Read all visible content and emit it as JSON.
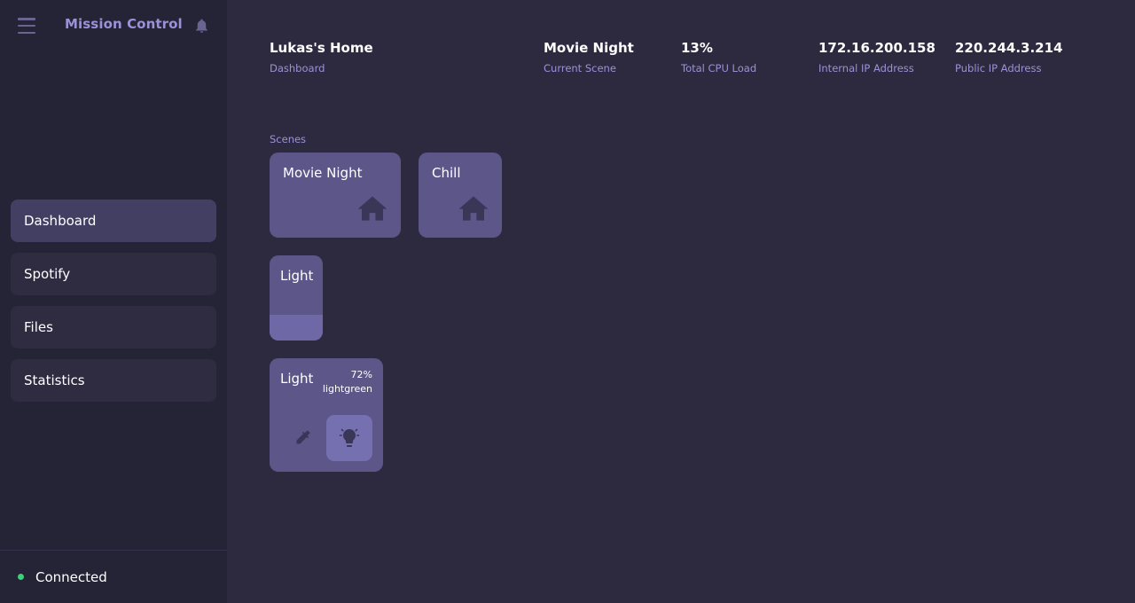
{
  "app": {
    "title": "Mission Control"
  },
  "sidebar": {
    "items": [
      {
        "label": "Dashboard",
        "active": true
      },
      {
        "label": "Spotify",
        "active": false
      },
      {
        "label": "Files",
        "active": false
      },
      {
        "label": "Statistics",
        "active": false
      }
    ],
    "status": "Connected",
    "status_color": "#3bd07a"
  },
  "header": {
    "home": {
      "value": "Lukas's Home",
      "label": "Dashboard"
    },
    "scene": {
      "value": "Movie Night",
      "label": "Current Scene"
    },
    "cpu": {
      "value": "13%",
      "label": "Total CPU Load"
    },
    "internal_ip": {
      "value": "172.16.200.158",
      "label": "Internal IP Address"
    },
    "public_ip": {
      "value": "220.244.3.214",
      "label": "Public IP Address"
    }
  },
  "scenes": {
    "label": "Scenes",
    "items": [
      {
        "name": "Movie Night",
        "icon": "home-icon"
      },
      {
        "name": "Chill",
        "icon": "home-icon"
      }
    ]
  },
  "dimmer": {
    "title": "Light",
    "level": 0.3
  },
  "color_light": {
    "title": "Light",
    "brightness": "72%",
    "color": "lightgreen",
    "picker_icon": "eyedropper-icon",
    "toggle_icon": "lightbulb-icon"
  },
  "colors": {
    "background": "#2d2a40",
    "sidebar": "#252336",
    "accent": "#9a92d8",
    "tile": "#5c5788",
    "active_nav": "#433f63"
  }
}
